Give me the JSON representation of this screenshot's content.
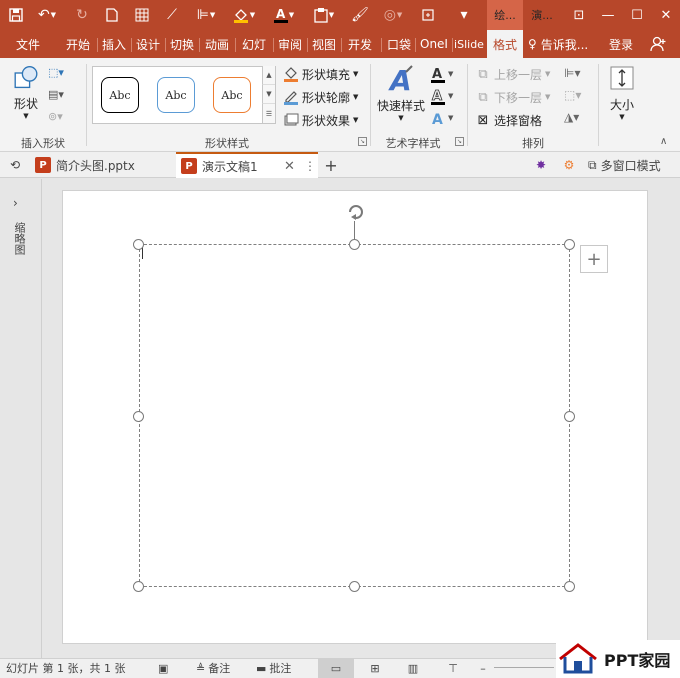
{
  "titlebar": {
    "context_group_1": "绘...",
    "context_group_2": "演...",
    "window_buttons": {
      "restore_ribbon": "⊡",
      "minimize": "—",
      "maximize": "☐",
      "close": "✕"
    }
  },
  "menu": {
    "tabs": [
      "文件",
      "开始",
      "插入",
      "设计",
      "切换",
      "动画",
      "幻灯",
      "审阅",
      "视图",
      "开发",
      "口袋",
      "OneI",
      "iSlide",
      "格式"
    ],
    "active_tab": "格式",
    "tell_me": "告诉我...",
    "login": "登录"
  },
  "ribbon": {
    "insert_shapes": {
      "shape_label": "形状",
      "group_label": "插入形状"
    },
    "shape_styles": {
      "gallery": [
        "Abc",
        "Abc",
        "Abc"
      ],
      "fill": "形状填充",
      "outline": "形状轮廓",
      "effects": "形状效果",
      "group_label": "形状样式"
    },
    "wordart": {
      "quick_styles": "快速样式",
      "group_label": "艺术字样式"
    },
    "arrange": {
      "bring_forward": "上移一层",
      "send_backward": "下移一层",
      "selection_pane": "选择窗格",
      "group_label": "排列"
    },
    "size": {
      "label": "大小"
    }
  },
  "doc_tabs": {
    "tab1": "简介头图.pptx",
    "tab2": "演示文稿1",
    "multi_window": "多窗口模式"
  },
  "left_pane": {
    "label": "缩略图"
  },
  "statusbar": {
    "slide_info": "幻灯片 第 1 张，共 1 张",
    "notes": "备注",
    "comments": "批注",
    "watermark": "PPT家园"
  },
  "colors": {
    "accent": "#b7472a",
    "ribbon_bg": "#f3f3f3",
    "gallery_black": "#000000",
    "gallery_blue": "#5b9bd5",
    "gallery_orange": "#ed7d31"
  }
}
